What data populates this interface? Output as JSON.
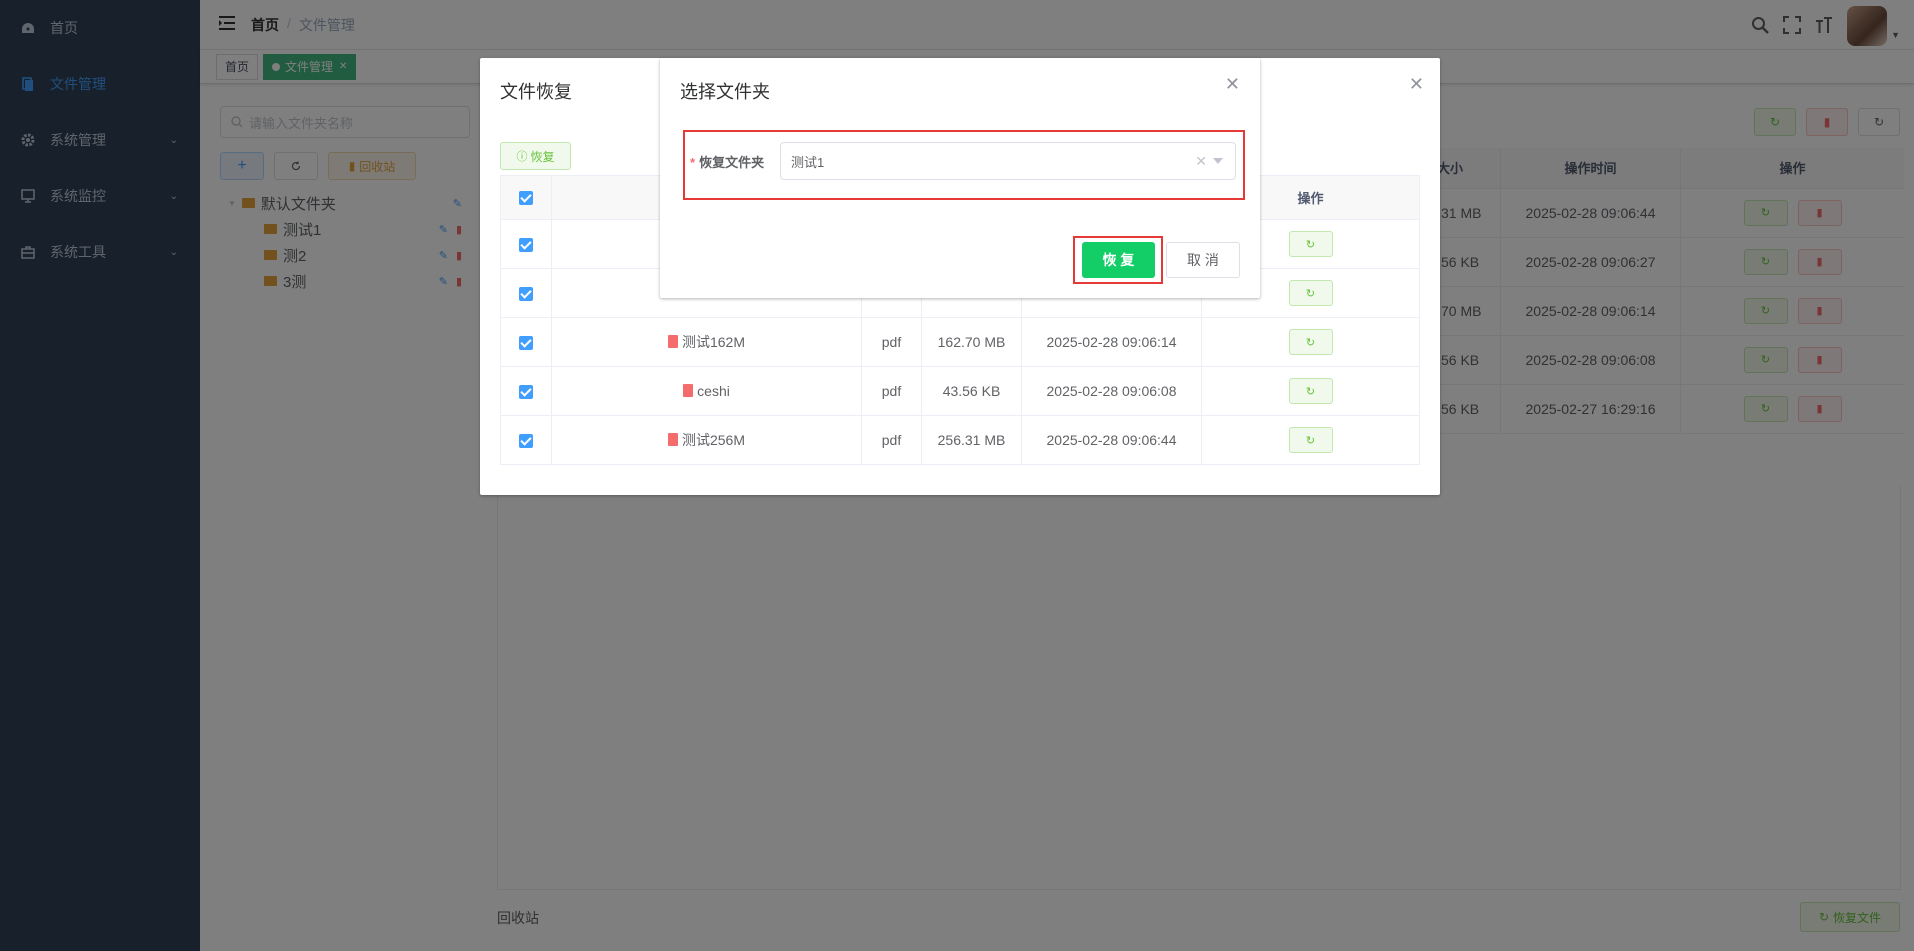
{
  "sidebar": {
    "items": [
      {
        "label": "首页",
        "icon": "dashboard-icon"
      },
      {
        "label": "文件管理",
        "icon": "file-icon",
        "active": true
      },
      {
        "label": "系统管理",
        "icon": "gear-icon"
      },
      {
        "label": "系统监控",
        "icon": "monitor-icon"
      },
      {
        "label": "系统工具",
        "icon": "toolbox-icon"
      }
    ]
  },
  "navbar": {
    "breadcrumb": [
      "首页",
      "文件管理"
    ],
    "separator": "/"
  },
  "tags": {
    "home": "首页",
    "current": "文件管理"
  },
  "folders": {
    "search_placeholder": "请输入文件夹名称",
    "recycle_label": "回收站",
    "tree": {
      "root": "默认文件夹",
      "children": [
        "测试1",
        "测2",
        "3测"
      ]
    }
  },
  "background_table": {
    "headers": [
      "大小",
      "操作时间",
      "操作"
    ],
    "rows": [
      {
        "size": "31 MB",
        "time": "2025-02-28 09:06:44"
      },
      {
        "size": "56 KB",
        "time": "2025-02-28 09:06:27"
      },
      {
        "size": "70 MB",
        "time": "2025-02-28 09:06:14"
      },
      {
        "size": "56 KB",
        "time": "2025-02-28 09:06:08"
      },
      {
        "size": "56 KB",
        "time": "2025-02-27 16:29:16"
      }
    ]
  },
  "footer": {
    "recycle_label": "回收站",
    "recover_file_label": "恢复文件"
  },
  "file_restore_dialog": {
    "title": "文件恢复",
    "restore_label": "恢复",
    "action_header": "操作",
    "rows": [
      {
        "name": "测试162M",
        "type": "pdf",
        "size": "162.70 MB",
        "time": "2025-02-28 09:06:14"
      },
      {
        "name": "ceshi",
        "type": "pdf",
        "size": "43.56 KB",
        "time": "2025-02-28 09:06:08"
      },
      {
        "name": "测试256M",
        "type": "pdf",
        "size": "256.31 MB",
        "time": "2025-02-28 09:06:44"
      }
    ]
  },
  "select_folder_dialog": {
    "title": "选择文件夹",
    "field_label": "恢复文件夹",
    "selected_value": "测试1",
    "confirm_label": "恢 复",
    "cancel_label": "取 消"
  },
  "colors": {
    "sidebar_bg": "#304156",
    "primary": "#409eff",
    "success": "#13ce66",
    "danger": "#f56c6c",
    "highlight": "#e53935"
  }
}
